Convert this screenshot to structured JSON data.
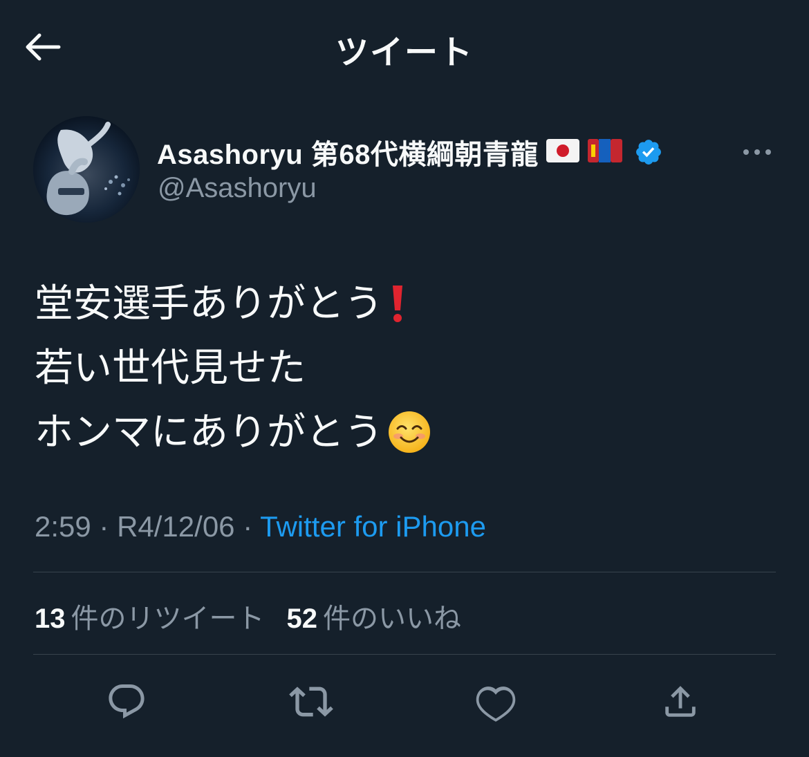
{
  "header": {
    "title": "ツイート",
    "back_icon": "arrow-left-icon"
  },
  "author": {
    "display_name": "Asashoryu 第68代横綱朝青龍",
    "flags": [
      "flag-japan-icon",
      "flag-mongolia-icon"
    ],
    "verified_icon": "verified-badge-icon",
    "handle": "@Asashoryu",
    "more_icon": "more-horizontal-icon"
  },
  "tweet": {
    "lines": [
      {
        "text": "堂安選手ありがとう",
        "emoji": "red-exclamation-icon"
      },
      {
        "text": "若い世代見せた"
      },
      {
        "text": "ホンマにありがとう",
        "emoji": "smiling-face-icon"
      }
    ]
  },
  "meta": {
    "time": "2:59",
    "sep1": " · ",
    "date": "R4/12/06",
    "sep2": " · ",
    "source": "Twitter for iPhone"
  },
  "stats": {
    "retweets_count": "13",
    "retweets_label": "件のリツイート",
    "likes_count": "52",
    "likes_label": "件のいいね"
  },
  "actions": [
    "reply-icon",
    "retweet-icon",
    "like-icon",
    "share-icon"
  ],
  "colors": {
    "background": "#15202b",
    "text_primary": "#f7f9f9",
    "text_secondary": "#8b98a5",
    "accent": "#1d9bf0",
    "divider": "#38444d"
  }
}
